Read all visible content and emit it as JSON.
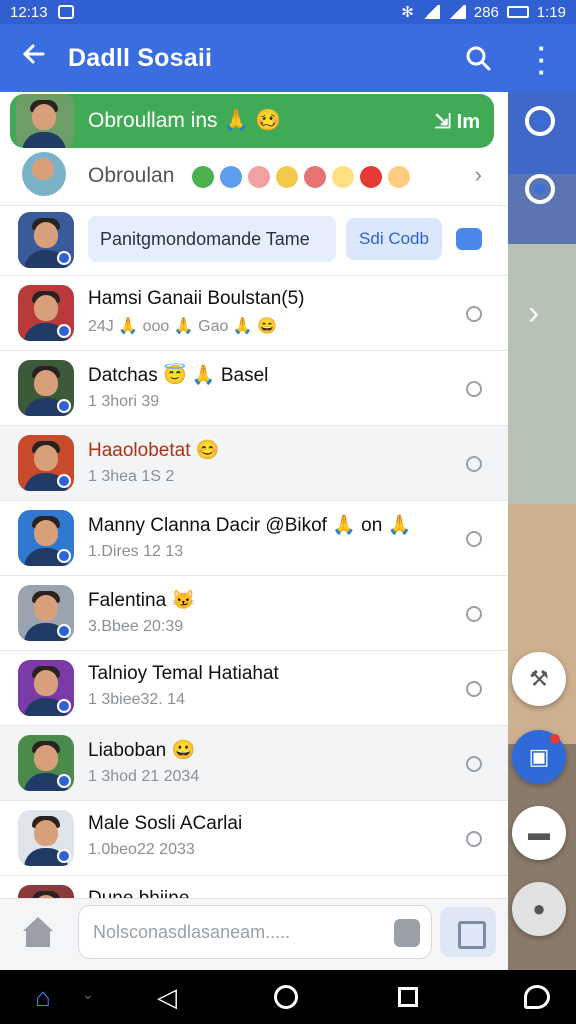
{
  "status_bar": {
    "time": "12:13",
    "right_text": "286",
    "clock_right": "1:19"
  },
  "app_bar": {
    "title": "Dadll Sosaii"
  },
  "banner": {
    "name": "Obroullam ins 🙏 🥴",
    "action": "Im"
  },
  "row2": {
    "name": "Obroulan"
  },
  "row3": {
    "bubble": "Panitgmondomande Tame",
    "chip": "Sdi Codb"
  },
  "chats": [
    {
      "name": "Hamsi Ganaii Boulstan(5)",
      "meta": "24J 🙏 ooo 🙏 Gao 🙏 😄",
      "alt": false,
      "avatar_bg": "#b83a3a",
      "red": false
    },
    {
      "name": "Datchas 😇 🙏 Basel",
      "meta": "1 3hori 39",
      "alt": false,
      "avatar_bg": "#3c5a3a",
      "red": false
    },
    {
      "name": "Haaolobetat 😊",
      "meta": "1 3hea 1S 2",
      "alt": true,
      "avatar_bg": "#c84a2a",
      "red": true
    },
    {
      "name": "Manny Clanna Dacir @Bikof 🙏 on 🙏",
      "meta": "1.Dires 12 13",
      "alt": false,
      "avatar_bg": "#2f7ad0",
      "red": false
    },
    {
      "name": "Falentina 😼",
      "meta": "3.Bbee 20:39",
      "alt": false,
      "avatar_bg": "#9aa4ae",
      "red": false
    },
    {
      "name": "Talnioy Temal Hatiahat",
      "meta": "1 3biee32. 14",
      "alt": false,
      "avatar_bg": "#7a3aa8",
      "red": false
    },
    {
      "name": "Liaboban 😀",
      "meta": "1 3hod 21 2034",
      "alt": true,
      "avatar_bg": "#4a8a4a",
      "red": false
    },
    {
      "name": "Male Sosli ACarlai",
      "meta": "1.0beo22 2033",
      "alt": false,
      "avatar_bg": "#dfe4ea",
      "red": false
    },
    {
      "name": "Dune bhiine",
      "meta": "",
      "alt": false,
      "avatar_bg": "#8a3a3a",
      "red": false
    }
  ],
  "composer": {
    "placeholder": "Nolsconasdlasaneam....."
  },
  "icons": {
    "back": "arrow-left-icon",
    "search": "search-icon",
    "more": "more-vert-icon"
  }
}
